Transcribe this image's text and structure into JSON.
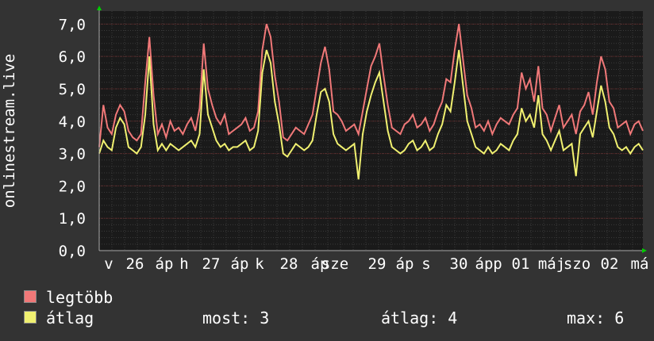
{
  "chart_data": {
    "type": "line",
    "ylabel": "onlinestream.live",
    "yticks": [
      "0,0",
      "1,0",
      "2,0",
      "3,0",
      "4,0",
      "5,0",
      "6,0",
      "7,0"
    ],
    "ylim": [
      0,
      7.4
    ],
    "xtick_labels": [
      "v",
      "26",
      "áp",
      "h",
      "27",
      "áp",
      "k",
      "28",
      "áp",
      "sze",
      "29",
      "áp",
      "s",
      "30",
      "áp",
      "p",
      "01",
      "máj",
      "szo",
      "02",
      "má"
    ],
    "grid": true,
    "series": [
      {
        "name": "legtöbb",
        "color": "#f07878",
        "values": [
          3.2,
          4.5,
          3.8,
          3.6,
          4.2,
          4.5,
          4.3,
          3.7,
          3.5,
          3.4,
          3.6,
          5.2,
          6.6,
          4.8,
          3.6,
          3.9,
          3.5,
          4.0,
          3.7,
          3.8,
          3.6,
          3.9,
          4.1,
          3.7,
          4.4,
          6.4,
          5.0,
          4.5,
          4.1,
          3.9,
          4.2,
          3.6,
          3.7,
          3.8,
          3.9,
          4.1,
          3.7,
          3.8,
          4.3,
          6.2,
          7.0,
          6.6,
          5.4,
          4.6,
          3.5,
          3.4,
          3.6,
          3.8,
          3.7,
          3.6,
          3.9,
          4.2,
          5.0,
          5.8,
          6.3,
          5.6,
          4.3,
          4.2,
          4.0,
          3.7,
          3.8,
          3.9,
          3.6,
          4.3,
          5.0,
          5.7,
          6.0,
          6.4,
          5.4,
          4.5,
          3.8,
          3.7,
          3.6,
          3.9,
          4.0,
          4.2,
          3.8,
          3.9,
          4.1,
          3.7,
          3.9,
          4.3,
          4.6,
          5.3,
          5.2,
          6.2,
          7.0,
          5.9,
          4.8,
          4.4,
          3.8,
          3.9,
          3.7,
          4.0,
          3.6,
          3.9,
          4.1,
          4.0,
          3.9,
          4.2,
          4.4,
          5.5,
          5.0,
          5.3,
          4.6,
          5.7,
          4.4,
          4.2,
          3.7,
          4.1,
          4.5,
          3.8,
          4.0,
          4.2,
          3.6,
          4.3,
          4.5,
          4.9,
          4.2,
          5.2,
          6.0,
          5.6,
          4.6,
          4.4,
          3.8,
          3.9,
          4.0,
          3.6,
          3.9,
          4.0,
          3.7
        ]
      },
      {
        "name": "átlag",
        "color": "#f0f070",
        "values": [
          3.0,
          3.4,
          3.2,
          3.1,
          3.8,
          4.1,
          3.9,
          3.2,
          3.1,
          3.0,
          3.2,
          4.2,
          6.0,
          3.9,
          3.1,
          3.3,
          3.1,
          3.3,
          3.2,
          3.1,
          3.2,
          3.3,
          3.4,
          3.2,
          3.6,
          5.6,
          4.2,
          3.8,
          3.4,
          3.2,
          3.3,
          3.1,
          3.2,
          3.2,
          3.3,
          3.4,
          3.1,
          3.2,
          3.7,
          5.5,
          6.2,
          5.8,
          4.6,
          3.9,
          3.0,
          2.9,
          3.1,
          3.3,
          3.2,
          3.1,
          3.2,
          3.4,
          4.2,
          4.9,
          5.0,
          4.6,
          3.6,
          3.3,
          3.2,
          3.1,
          3.2,
          3.3,
          2.2,
          3.6,
          4.3,
          4.8,
          5.2,
          5.5,
          4.6,
          3.7,
          3.2,
          3.1,
          3.0,
          3.1,
          3.3,
          3.4,
          3.1,
          3.2,
          3.4,
          3.1,
          3.2,
          3.6,
          3.9,
          4.5,
          4.3,
          5.2,
          6.2,
          5.1,
          4.0,
          3.6,
          3.2,
          3.1,
          3.0,
          3.2,
          3.0,
          3.1,
          3.3,
          3.2,
          3.1,
          3.4,
          3.6,
          4.4,
          4.0,
          4.2,
          3.8,
          4.8,
          3.6,
          3.4,
          3.1,
          3.4,
          3.7,
          3.1,
          3.2,
          3.3,
          2.3,
          3.6,
          3.8,
          4.0,
          3.5,
          4.3,
          5.1,
          4.6,
          3.8,
          3.6,
          3.2,
          3.1,
          3.2,
          3.0,
          3.2,
          3.3,
          3.1
        ]
      }
    ]
  },
  "legend": {
    "max_label": "legtöbb",
    "avg_label": "átlag",
    "now": "most: 3",
    "average": "átlag: 4",
    "maximum": "max: 6"
  }
}
